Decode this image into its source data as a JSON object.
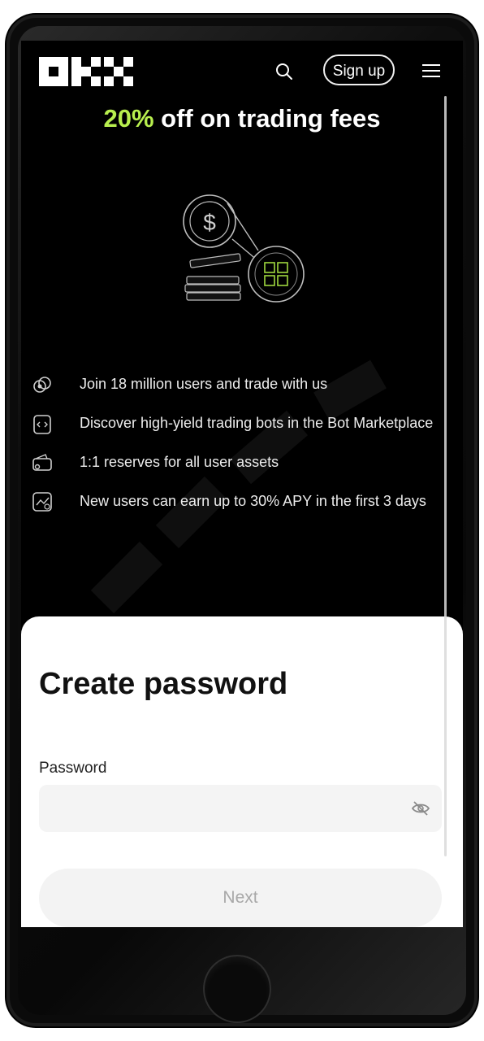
{
  "header": {
    "signup_label": "Sign up"
  },
  "promo": {
    "accent": "20%",
    "rest": " off on trading fees",
    "accent_color": "#b8ef4e"
  },
  "features": [
    {
      "icon": "users-coins-icon",
      "text": "Join 18 million users and trade with us"
    },
    {
      "icon": "bot-icon",
      "text": "Discover high-yield trading bots in the Bot Marketplace"
    },
    {
      "icon": "wallet-icon",
      "text": "1:1 reserves for all user assets"
    },
    {
      "icon": "chart-icon",
      "text": "New users can earn up to 30% APY in the first 3 days"
    }
  ],
  "sheet": {
    "title": "Create password",
    "password_label": "Password",
    "password_value": "",
    "next_label": "Next"
  }
}
